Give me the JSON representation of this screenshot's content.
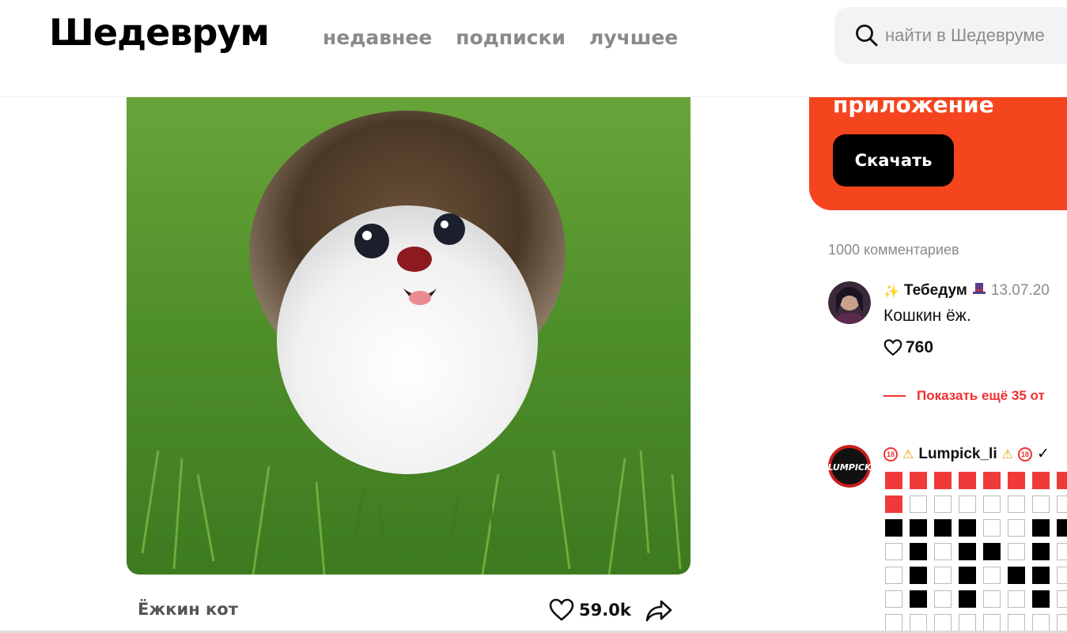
{
  "header": {
    "logo": "Шедеврум",
    "nav": [
      "недавнее",
      "подписки",
      "лучшее"
    ],
    "search_placeholder": "найти в Шедевруме"
  },
  "post": {
    "title": "Ёжкин кот",
    "likes": "59.0k",
    "image_subject": "hedgehog-cat on grass"
  },
  "promo": {
    "title": "приложение",
    "button": "Скачать",
    "bg_color": "#f5451f"
  },
  "comments": {
    "count_label": "1000 комментариев",
    "items": [
      {
        "author": "Тебедум",
        "date": "13.07.20",
        "text": "Кошкин ёж.",
        "likes": "760"
      },
      {
        "author": "Lumpick_li",
        "avatar_text": "LUMPICK",
        "check": "✓"
      }
    ],
    "show_more": "Показать ещё 35 от"
  },
  "colors": {
    "accent_red": "#f03030",
    "text_gray": "#8a8a8a"
  }
}
